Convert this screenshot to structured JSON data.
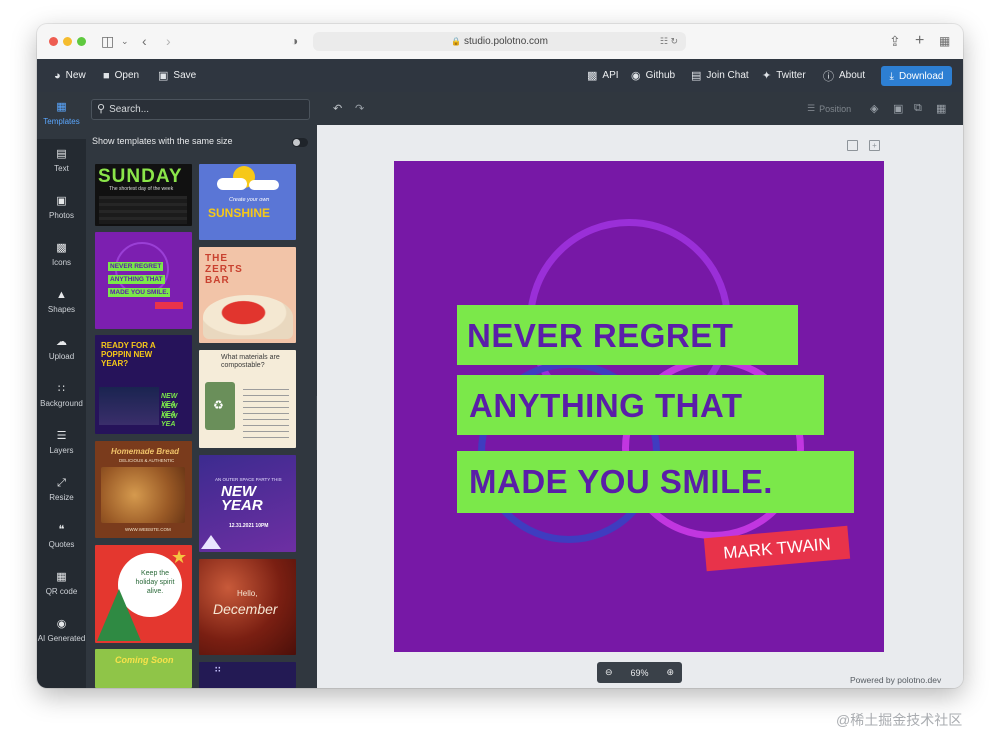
{
  "browser": {
    "url": "studio.polotno.com",
    "traffic_colors": [
      "#ee5d51",
      "#f5bc2e",
      "#5fc93f"
    ]
  },
  "toolbar": {
    "left": [
      {
        "icon": "new-file-icon",
        "label": "New"
      },
      {
        "icon": "folder-icon",
        "label": "Open"
      },
      {
        "icon": "save-icon",
        "label": "Save"
      }
    ],
    "right": [
      {
        "icon": "code-icon",
        "label": "API"
      },
      {
        "icon": "github-icon",
        "label": "Github"
      },
      {
        "icon": "discord-icon",
        "label": "Join Chat"
      },
      {
        "icon": "twitter-icon",
        "label": "Twitter"
      },
      {
        "icon": "info-icon",
        "label": "About"
      }
    ],
    "download_label": "Download",
    "accent": "#2d7fd3"
  },
  "sidebar": {
    "tabs": [
      {
        "icon": "templates-icon",
        "label": "Templates",
        "active": true
      },
      {
        "icon": "text-icon",
        "label": "Text"
      },
      {
        "icon": "photos-icon",
        "label": "Photos"
      },
      {
        "icon": "icons-icon",
        "label": "Icons"
      },
      {
        "icon": "shapes-icon",
        "label": "Shapes"
      },
      {
        "icon": "upload-icon",
        "label": "Upload"
      },
      {
        "icon": "background-icon",
        "label": "Background"
      },
      {
        "icon": "layers-icon",
        "label": "Layers"
      },
      {
        "icon": "resize-icon",
        "label": "Resize"
      },
      {
        "icon": "quotes-icon",
        "label": "Quotes"
      },
      {
        "icon": "qr-code-icon",
        "label": "QR code"
      },
      {
        "icon": "ai-icon",
        "label": "AI Generated"
      }
    ]
  },
  "templates_panel": {
    "search_placeholder": "Search...",
    "same_size_label": "Show templates with the same size",
    "same_size_enabled": false,
    "thumbs": {
      "sunday_title": "SUNDAY",
      "sunday_sub": "The shortest day of the week",
      "sunshine_small": "Create your own",
      "sunshine_title": "SUNSHINE",
      "regret_lines": [
        "NEVER REGRET",
        "ANYTHING THAT",
        "MADE YOU SMILE."
      ],
      "zerts_title": "THE ZERTS BAR",
      "poppin_title": "READY FOR A POPPIN NEW YEAR?",
      "newyear_repeat": "NEW YEA",
      "materials_title": "What materials are compostable?",
      "bread_title": "Homemade Bread",
      "bread_sub": "DELICIOUS & AUTHENTIC",
      "bread_url": "WWW.WEBSITE.COM",
      "space_party_small": "AN OUTER SPACE PARTY THIS",
      "space_party_title": "NEW YEAR",
      "space_party_time": "12.31.2021 10PM",
      "holiday_text": "Keep the holiday spirit alive.",
      "december_small": "Hello,",
      "december_title": "December",
      "coming_soon": "Coming Soon"
    }
  },
  "canvas": {
    "background": "#7718a6",
    "quote_lines": [
      "NEVER  REGRET",
      "ANYTHING THAT",
      "MADE YOU SMILE."
    ],
    "author": "MARK TWAIN",
    "band_color": "#7be84a",
    "text_color": "#5a1ea8",
    "author_color": "#e8334a"
  },
  "workspace": {
    "position_label": "Position",
    "zoom": "69%",
    "powered_by": "Powered by polotno.dev"
  },
  "watermark": "@稀土掘金技术社区"
}
